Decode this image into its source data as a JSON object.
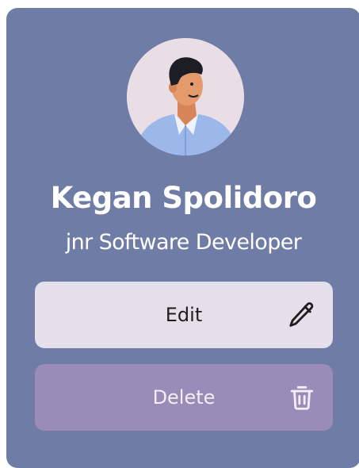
{
  "profile": {
    "name": "Kegan Spolidoro",
    "role": "jnr Software Developer",
    "avatar_icon": "person-avatar-icon"
  },
  "actions": {
    "edit_label": "Edit",
    "edit_icon": "pencil-icon",
    "delete_label": "Delete",
    "delete_icon": "trash-icon"
  },
  "colors": {
    "card_background": "#6f7ca6",
    "edit_button": "#e5dfec",
    "delete_button": "#9a8bb8"
  }
}
